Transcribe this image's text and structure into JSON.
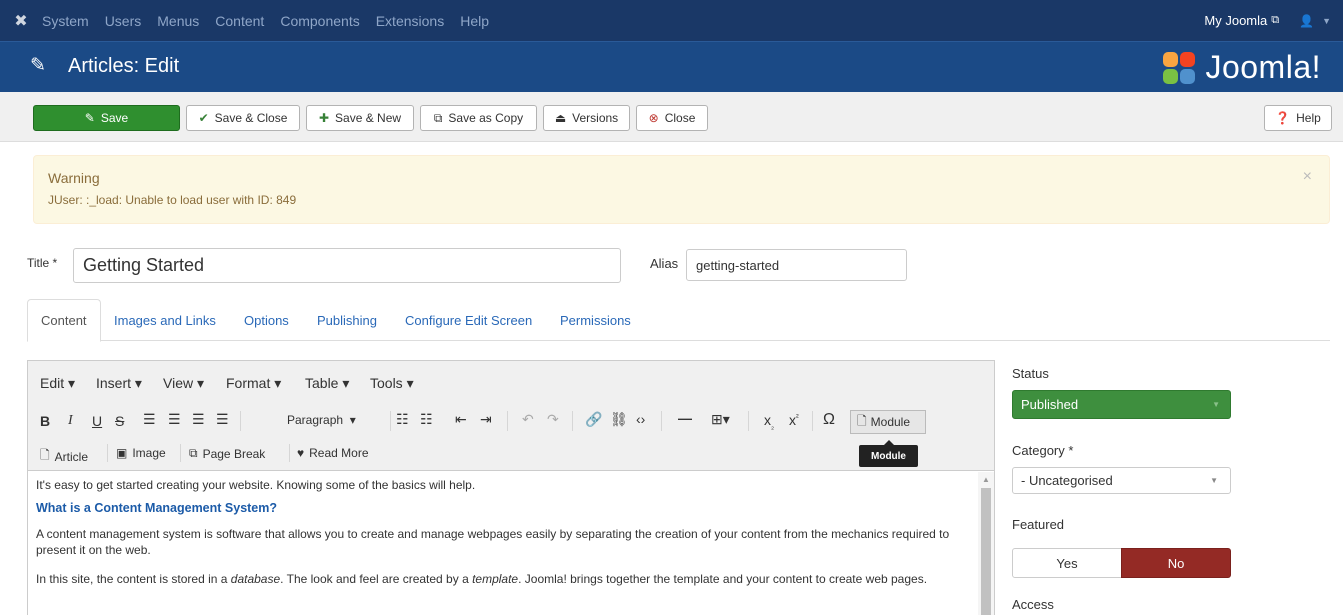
{
  "navbar": {
    "logo_icon": "joomla-icon",
    "menu": [
      "System",
      "Users",
      "Menus",
      "Content",
      "Components",
      "Extensions",
      "Help"
    ],
    "site_link": "My Joomla",
    "user_icon": "user-icon"
  },
  "header": {
    "title": "Articles: Edit",
    "brand": "Joomla!"
  },
  "toolbar": {
    "save": "Save",
    "save_close": "Save & Close",
    "save_new": "Save & New",
    "save_copy": "Save as Copy",
    "versions": "Versions",
    "close": "Close",
    "help": "Help"
  },
  "alert": {
    "heading": "Warning",
    "message": "JUser: :_load: Unable to load user with ID: 849",
    "close": "×"
  },
  "form": {
    "title_label": "Title *",
    "title_value": "Getting Started",
    "alias_label": "Alias",
    "alias_value": "getting-started"
  },
  "tabs": [
    "Content",
    "Images and Links",
    "Options",
    "Publishing",
    "Configure Edit Screen",
    "Permissions"
  ],
  "editor": {
    "menus": [
      "Edit",
      "Insert",
      "View",
      "Format",
      "Table",
      "Tools"
    ],
    "format_select": "Paragraph",
    "module_button": "Module",
    "tooltip": "Module",
    "row3": [
      "Article",
      "Image",
      "Page Break",
      "Read More"
    ],
    "content": {
      "p1": "It's easy to get started creating your website. Knowing some of the basics will help.",
      "h1": "What is a Content Management System?",
      "p2": "A content management system is software that allows you to create and manage webpages easily by separating the creation of your content from the mechanics required to present it on the web.",
      "p3_a": "In this site, the content is stored in a ",
      "p3_b": "database",
      "p3_c": ". The look and feel are created by a ",
      "p3_d": "template",
      "p3_e": ". Joomla! brings together the template and your content to create web pages."
    }
  },
  "side": {
    "status_label": "Status",
    "status_value": "Published",
    "category_label": "Category *",
    "category_value": "- Uncategorised",
    "featured_label": "Featured",
    "featured_yes": "Yes",
    "featured_no": "No",
    "access_label": "Access"
  },
  "colors": {
    "navbar": "#1a3867",
    "header": "#1b4a86",
    "save_green": "#2f8f2f",
    "published_green": "#3e8f3e",
    "no_red": "#942a25",
    "alert_bg": "#fcf8e3",
    "link_blue": "#2a69b8"
  }
}
